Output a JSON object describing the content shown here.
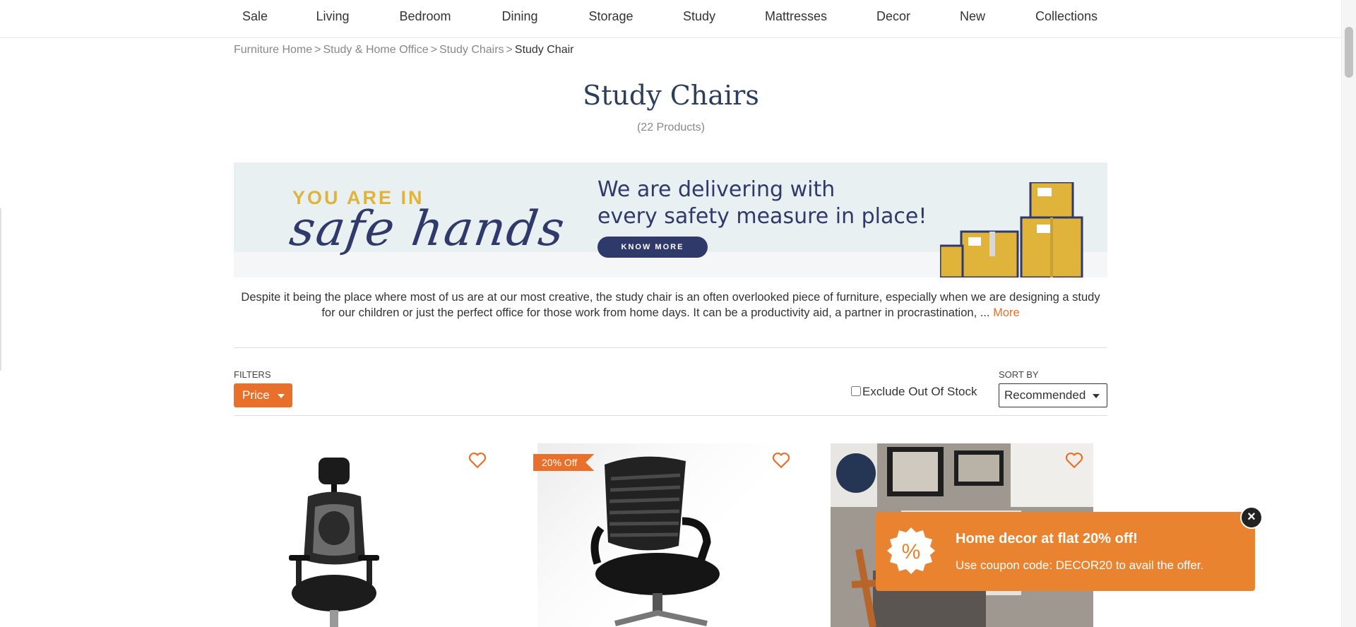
{
  "nav": {
    "items": [
      "Sale",
      "Living",
      "Bedroom",
      "Dining",
      "Storage",
      "Study",
      "Mattresses",
      "Decor",
      "New",
      "Collections"
    ]
  },
  "breadcrumb": {
    "items": [
      "Furniture Home",
      "Study & Home Office",
      "Study Chairs"
    ],
    "separator": ">",
    "current": "Study Chair"
  },
  "page": {
    "title": "Study Chairs",
    "count": "(22 Products)"
  },
  "banner": {
    "tagline_top": "YOU ARE IN",
    "tagline_script": "safe hands",
    "headline_line1": "We are delivering with",
    "headline_line2": "every safety measure in place!",
    "button": "KNOW MORE"
  },
  "description": {
    "text": "Despite it being the place where most of us are at our most creative, the study chair is an often overlooked piece of furniture, especially when we are designing a study for our children or just the perfect office for those work from home days. It can be a productivity aid, a partner in procrastination, ...",
    "more": "More"
  },
  "filters": {
    "label": "FILTERS",
    "price": "Price",
    "exclude_out_of_stock": "Exclude Out Of Stock",
    "exclude_checked": false,
    "sort_label": "SORT BY",
    "sort_value": "Recommended"
  },
  "products": [
    {
      "badge": ""
    },
    {
      "badge": "20% Off"
    },
    {
      "badge": ""
    }
  ],
  "promo": {
    "icon": "%",
    "title": "Home decor at flat 20% off!",
    "subtitle": "Use coupon code: DECOR20 to avail the offer.",
    "close": "×"
  },
  "colors": {
    "accent": "#e8702a",
    "promo_bg": "#ea8330",
    "title": "#2c3e5c",
    "banner_navy": "#2f3a6b",
    "banner_gold": "#e0b43a"
  }
}
